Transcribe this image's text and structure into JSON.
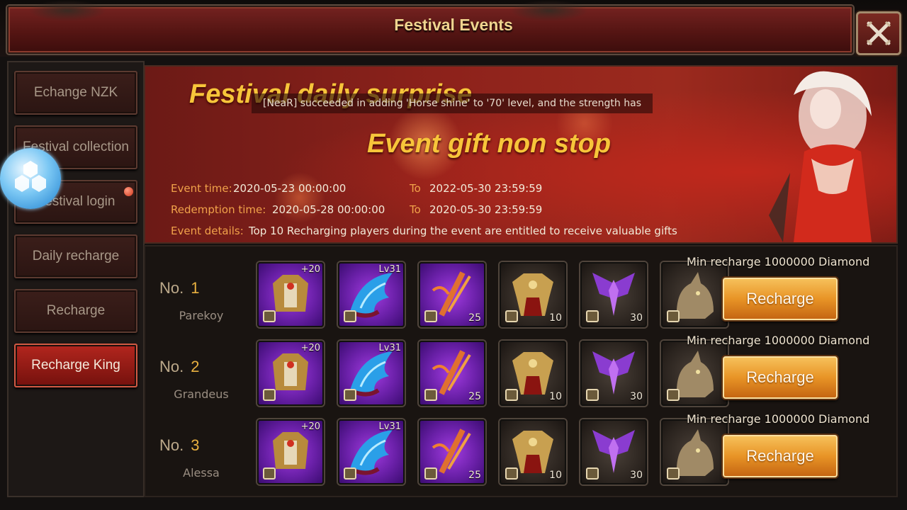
{
  "window": {
    "title": "Festival Events"
  },
  "sidebar": {
    "items": [
      {
        "label": "Echange NZK",
        "active": false,
        "dot": false
      },
      {
        "label": "Festival collection",
        "active": false,
        "dot": false
      },
      {
        "label": "Festival login",
        "active": false,
        "dot": true
      },
      {
        "label": "Daily recharge",
        "active": false,
        "dot": false
      },
      {
        "label": "Recharge",
        "active": false,
        "dot": false
      },
      {
        "label": "Recharge King",
        "active": true,
        "dot": false
      }
    ]
  },
  "banner": {
    "heading": "Festival daily surprise",
    "subheading": "Event gift non stop",
    "ticker": "[NeaR] succeeded in adding 'Horse shine' to '70' level, and the strength has",
    "event_time_label": "Event time:",
    "event_time_start": "2020-05-23 00:00:00",
    "to_label": "To",
    "event_time_end": "2022-05-30 23:59:59",
    "redemption_label": "Redemption time:",
    "redemption_start": "2020-05-28 00:00:00",
    "redemption_end": "2020-05-30 23:59:59",
    "details_label": "Event details:",
    "details_text": "Top 10 Recharging players during the event are entitled to receive valuable gifts"
  },
  "ranking": {
    "rank_prefix": "No.",
    "min_recharge": "Min recharge 1000000 Diamond",
    "button_label": "Recharge",
    "rows": [
      {
        "rank": "1",
        "player": "Parekoy"
      },
      {
        "rank": "2",
        "player": "Grandeus"
      },
      {
        "rank": "3",
        "player": "Alessa"
      }
    ],
    "rewards": [
      {
        "icon": "armor-chest-icon",
        "frame": "purple",
        "top": "+20",
        "bottom": ""
      },
      {
        "icon": "blue-wing-icon",
        "frame": "purple",
        "top": "Lv31",
        "bottom": ""
      },
      {
        "icon": "flame-staff-icon",
        "frame": "purple",
        "top": "",
        "bottom": "25"
      },
      {
        "icon": "golden-armor-icon",
        "frame": "dark",
        "top": "",
        "bottom": "10"
      },
      {
        "icon": "purple-wings-icon",
        "frame": "dark",
        "top": "",
        "bottom": "30"
      },
      {
        "icon": "wolf-mount-icon",
        "frame": "dark",
        "top": "",
        "bottom": ""
      }
    ]
  },
  "colors": {
    "accent": "#f7c53a",
    "active_tab": "#b3261e",
    "button": "#e89426"
  }
}
